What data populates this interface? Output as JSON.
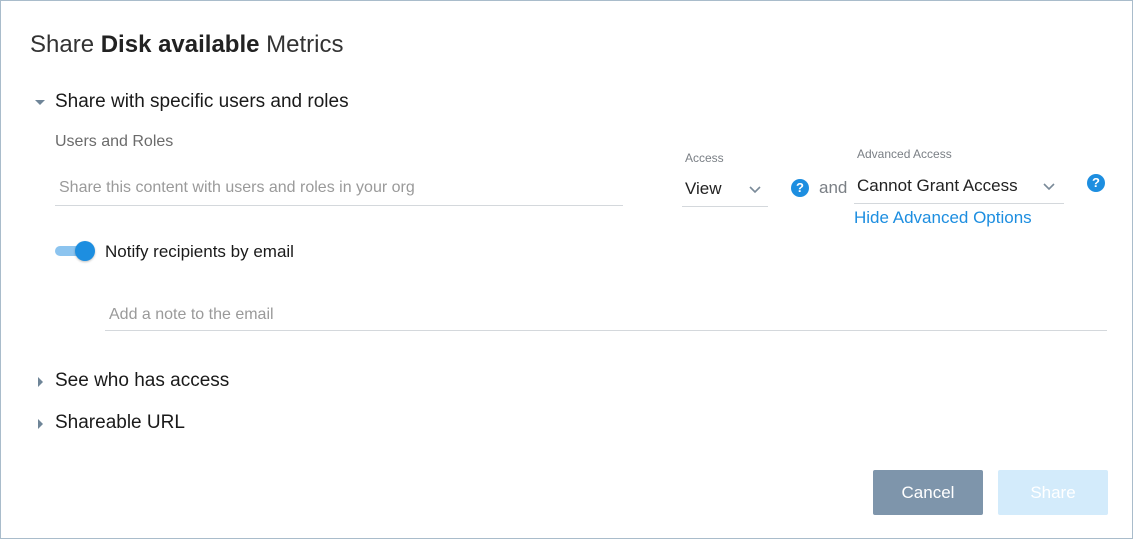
{
  "dialog": {
    "title_prefix": "Share",
    "title_subject": "Disk available",
    "title_suffix": "Metrics"
  },
  "sections": {
    "specific": {
      "label": "Share with specific users and roles",
      "expanded": true,
      "users_label": "Users and Roles",
      "users_placeholder": "Share this content with users and roles in your org",
      "access_label": "Access",
      "access_value": "View",
      "and_text": "and",
      "advanced_label": "Advanced Access",
      "advanced_value": "Cannot Grant Access",
      "hide_advanced_link": "Hide Advanced Options",
      "notify_label": "Notify recipients by email",
      "notify_on": true,
      "note_placeholder": "Add a note to the email",
      "help_glyph": "?"
    },
    "access": {
      "label": "See who has access",
      "expanded": false
    },
    "url": {
      "label": "Shareable URL",
      "expanded": false
    }
  },
  "buttons": {
    "cancel": "Cancel",
    "share": "Share"
  },
  "icons": {
    "expanded_caret": "caret-down-icon",
    "collapsed_caret": "caret-right-icon",
    "dropdown": "chevron-down-icon",
    "help": "help-icon"
  },
  "colors": {
    "accent": "#1d8ee0",
    "cancel_button": "#7e95ab",
    "share_button_disabled": "#d3ebfb",
    "border": "#a9bccb"
  }
}
